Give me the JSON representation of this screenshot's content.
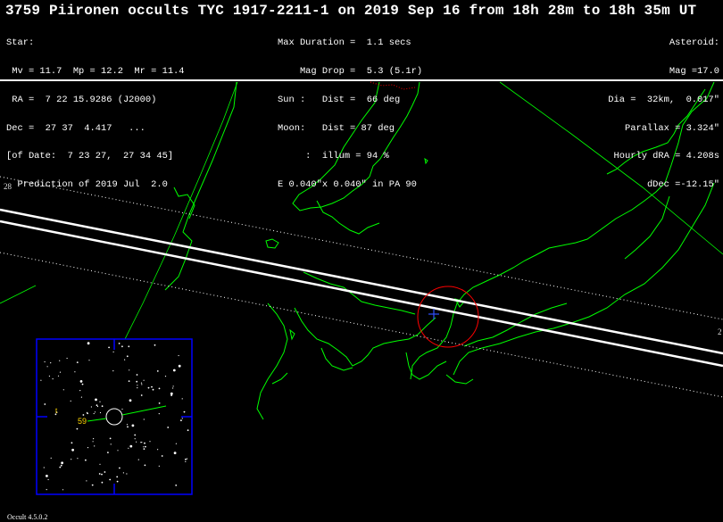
{
  "title": "3759 Piironen occults TYC 1917-2211-1 on 2019 Sep 16 from 18h 28m to 18h 35m UT",
  "star_block": [
    "Star:",
    " Mv = 11.7  Mp = 12.2  Mr = 11.4",
    " RA =  7 22 15.9286 (J2000)",
    "Dec =  27 37  4.417   ...",
    "[of Date:  7 23 27,  27 34 45]",
    "  Prediction of 2019 Jul  2.0"
  ],
  "event_block": [
    "Max Duration =  1.1 secs",
    "    Mag Drop =  5.3 (5.1r)",
    "Sun :   Dist =  66 deg",
    "Moon:   Dist = 87 deg",
    "     :  illum = 94 %",
    "E 0.040\"x 0.040\" in PA 90"
  ],
  "asteroid_block": [
    "Asteroid:",
    "Mag =17.0",
    "Dia =  32km,  0.017\"",
    "Parallax = 3.324\"",
    "Hourly dRA = 4.208s",
    "dDec =-12.15\""
  ],
  "map_labels": {
    "lat_left": "28",
    "lat_right": "2",
    "finder_star_mag": "59",
    "finder_mark": "t",
    "version": "Occult 4.5.0.2"
  },
  "colors": {
    "background": "#000000",
    "coastline": "#00ff00",
    "path": "#ffffff",
    "site_circle": "#ff0000",
    "site_cross": "#0000ff",
    "finder_frame": "#0000ff",
    "finder_label": "#ffd700"
  }
}
